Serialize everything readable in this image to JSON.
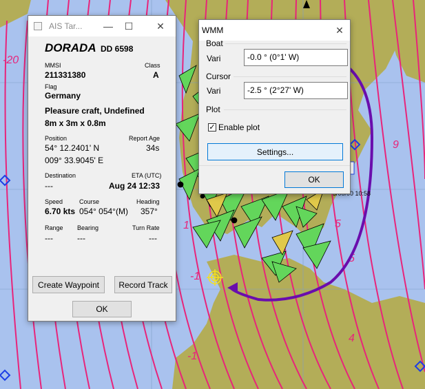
{
  "map": {
    "contour_labels": [
      "-20",
      "-1",
      "-1",
      "1",
      "5",
      "5",
      "9",
      "4"
    ],
    "timestamp_fragment": "5/00/00 10:58",
    "colors": {
      "water": "#a9c2ee",
      "land": "#b3ad58",
      "isogonic_line": "#e8247a",
      "boat_track": "#6a0dad"
    }
  },
  "ais_window": {
    "title": "AIS Tar...",
    "icons": [
      "minimize-icon",
      "maximize-icon",
      "close-icon"
    ],
    "vessel_name": "DORADA",
    "callsign": "DD 6598",
    "mmsi_label": "MMSI",
    "mmsi": "211331380",
    "class_label": "Class",
    "class_value": "A",
    "flag_label": "Flag",
    "flag": "Germany",
    "type": "Pleasure craft, Undefined",
    "dimensions": "8m x 3m x 0.8m",
    "position_label": "Position",
    "report_age_label": "Report Age",
    "lat": "54° 12.2401' N",
    "report_age": "34s",
    "lon": "009° 33.9045' E",
    "destination_label": "Destination",
    "eta_label": "ETA (UTC)",
    "destination": "---",
    "eta": "Aug 24 12:33",
    "speed_label": "Speed",
    "course_label": "Course",
    "heading_label": "Heading",
    "speed": "6.70 kts",
    "course": "054° 054°(M)",
    "heading": "357°",
    "range_label": "Range",
    "bearing_label": "Bearing",
    "turn_rate_label": "Turn Rate",
    "range": "---",
    "bearing": "---",
    "turn_rate": "---",
    "create_waypoint": "Create Waypoint",
    "record_track": "Record Track",
    "ok": "OK"
  },
  "wmm_window": {
    "title": "WMM",
    "boat_group": "Boat",
    "boat_vari_label": "Vari",
    "boat_vari": "-0.0 ° (0°1' W)",
    "cursor_group": "Cursor",
    "cursor_vari_label": "Vari",
    "cursor_vari": "-2.5 ° (2°27' W)",
    "plot_group": "Plot",
    "enable_plot_label": "Enable plot",
    "enable_plot_checked": true,
    "settings_button": "Settings...",
    "ok": "OK"
  }
}
